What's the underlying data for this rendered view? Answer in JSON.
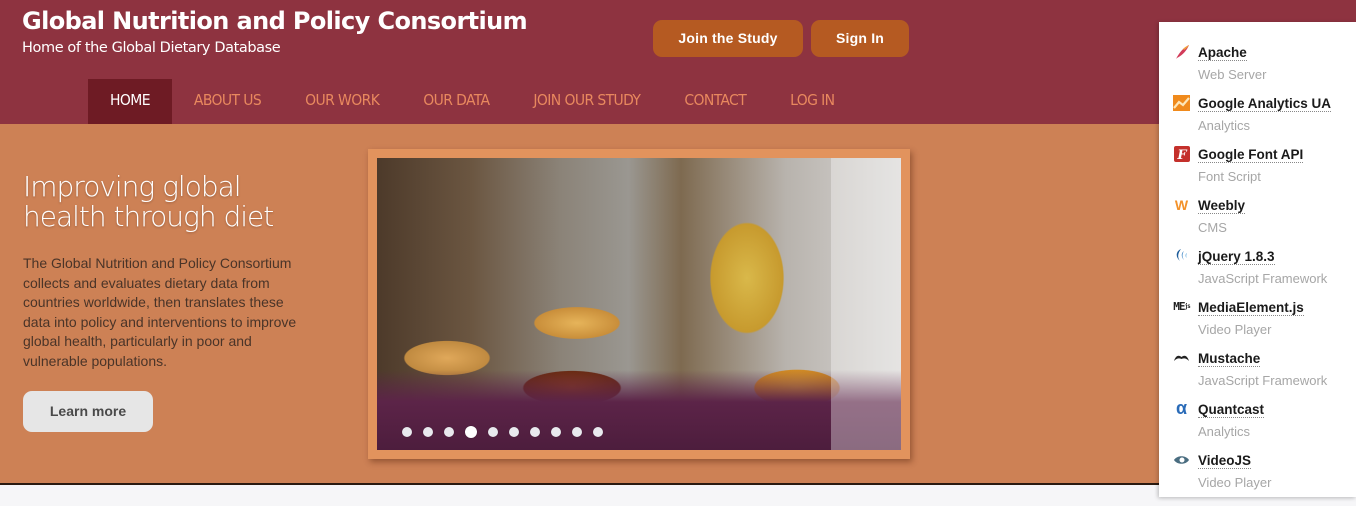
{
  "header": {
    "title": "Global Nutrition and Policy Consortium",
    "tagline": "Home of the Global Dietary Database",
    "buttons": {
      "join": "Join the Study",
      "signin": "Sign In"
    }
  },
  "nav": {
    "items": [
      {
        "label": "HOME",
        "active": true
      },
      {
        "label": "ABOUT US",
        "active": false
      },
      {
        "label": "OUR WORK",
        "active": false
      },
      {
        "label": "OUR DATA",
        "active": false
      },
      {
        "label": "JOIN OUR STUDY",
        "active": false
      },
      {
        "label": "CONTACT",
        "active": false
      },
      {
        "label": "LOG IN",
        "active": false
      }
    ]
  },
  "hero": {
    "heading": "Improving global health through diet",
    "body": "The Global Nutrition and Policy Consortium collects and evaluates dietary data from countries worldwide, then translates these data into policy and interventions to improve global health, particularly in poor and vulnerable populations.",
    "cta": "Learn more",
    "slider": {
      "slide_count": 10,
      "active_slide": 4,
      "image_description": "Woman in yellow sari preparing sweets at a market stall"
    }
  },
  "tech_panel": {
    "items": [
      {
        "name": "Apache",
        "category": "Web Server",
        "icon": "feather-icon"
      },
      {
        "name": "Google Analytics UA",
        "category": "Analytics",
        "icon": "analytics-chart-icon"
      },
      {
        "name": "Google Font API",
        "category": "Font Script",
        "icon": "font-f-icon"
      },
      {
        "name": "Weebly",
        "category": "CMS",
        "icon": "weebly-w-icon"
      },
      {
        "name": "jQuery 1.8.3",
        "category": "JavaScript Framework",
        "icon": "jquery-icon"
      },
      {
        "name": "MediaElement.js",
        "category": "Video Player",
        "icon": "mediaelement-icon"
      },
      {
        "name": "Mustache",
        "category": "JavaScript Framework",
        "icon": "mustache-icon"
      },
      {
        "name": "Quantcast",
        "category": "Analytics",
        "icon": "quantcast-alpha-icon"
      },
      {
        "name": "VideoJS",
        "category": "Video Player",
        "icon": "videojs-eye-icon"
      }
    ]
  },
  "colors": {
    "header_bg": "#8e3340",
    "nav_active_bg": "#6e1b24",
    "nav_text": "#e8885e",
    "button_bg": "#b55a22",
    "hero_bg": "#cd8155",
    "frame_bg": "#e2935d"
  }
}
